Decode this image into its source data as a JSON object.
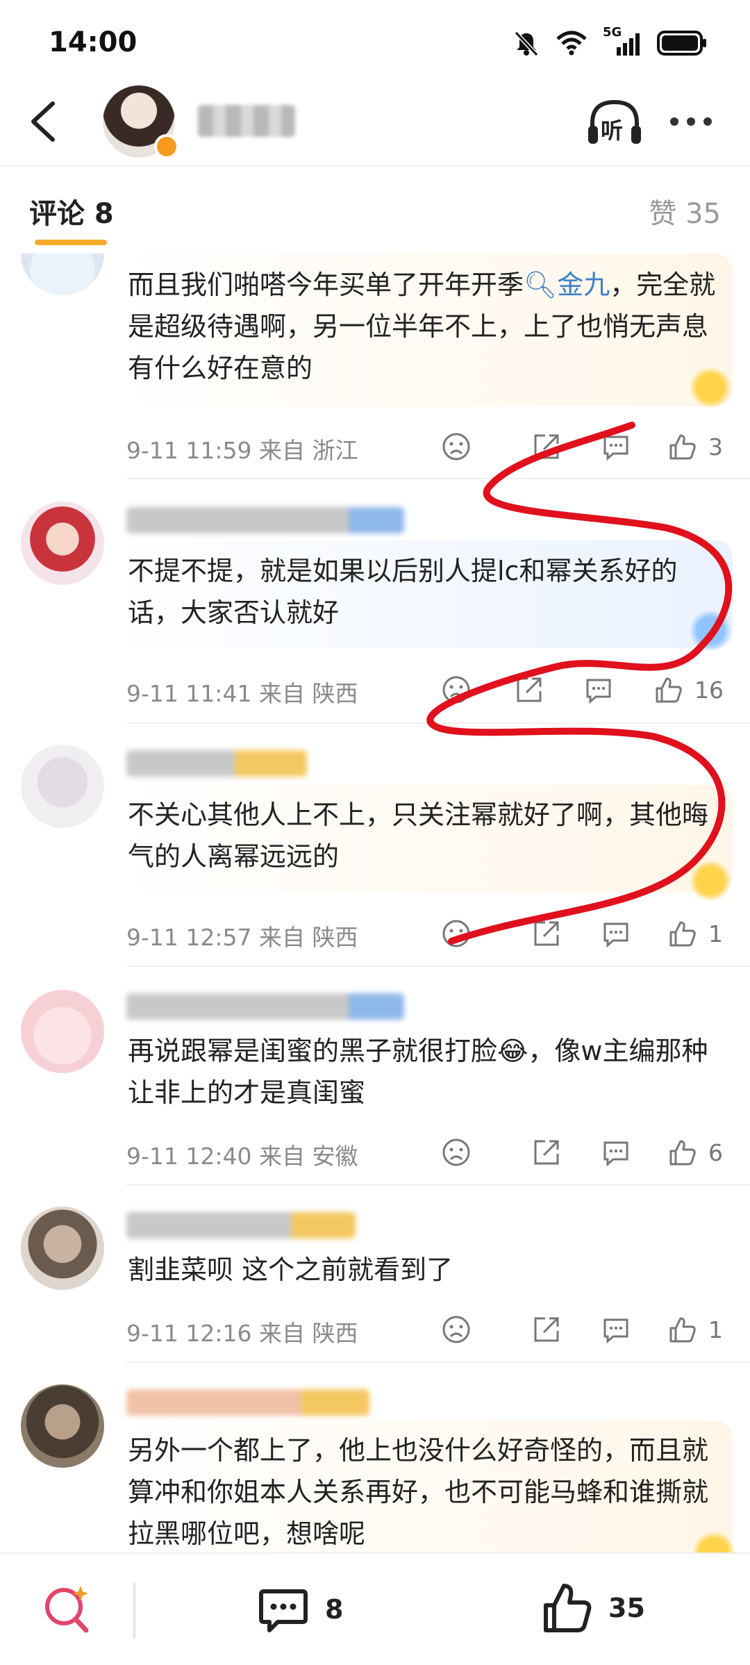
{
  "status_bar": {
    "time": "14:00",
    "network": "5G"
  },
  "header": {
    "listen_label": "听"
  },
  "tabs": {
    "comments_label": "评论 8",
    "likes_label": "赞 35"
  },
  "comments": [
    {
      "text_parts": [
        "而且我们啪嗒今年买单了开年开季",
        "金九",
        "，完全就是超级待遇啊，另一位半年不上，上了也悄无声息有什么好在意的"
      ],
      "keyword": "金九",
      "meta": "9-11 11:59 来自 浙江",
      "likes": "3"
    },
    {
      "text": "不提不提，就是如果以后别人提lc和幂关系好的话，大家否认就好",
      "meta": "9-11 11:41 来自 陕西",
      "likes": "16"
    },
    {
      "text": "不关心其他人上不上，只关注幂就好了啊，其他晦气的人离幂远远的",
      "meta": "9-11 12:57 来自 陕西",
      "likes": "1"
    },
    {
      "text_parts": [
        "再说跟幂是闺蜜的黑子就很打脸",
        "，像w主编那种让非上的才是真闺蜜"
      ],
      "meta": "9-11 12:40 来自 安徽",
      "likes": "6"
    },
    {
      "text": "割韭菜呗   这个之前就看到了",
      "meta": "9-11 12:16 来自 陕西",
      "likes": "1"
    },
    {
      "text": "另外一个都上了，他上也没什么好奇怪的，而且就算冲和你姐本人关系再好，也不可能马蜂和谁撕就拉黑哪位吧，想啥呢"
    }
  ],
  "bottom_bar": {
    "comments_count": "8",
    "likes_count": "35"
  },
  "colors": {
    "accent": "#f7a92b",
    "keyword": "#3e7fc7",
    "doodle": "#e0101c"
  }
}
